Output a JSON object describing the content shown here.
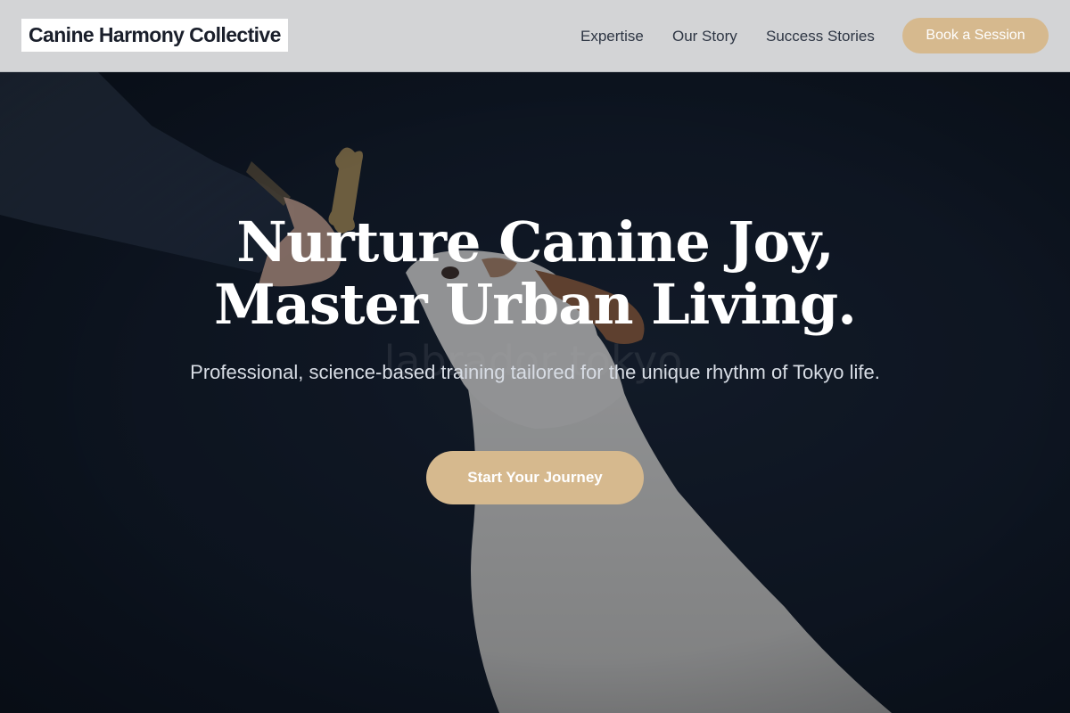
{
  "header": {
    "logo_text": "Canine Harmony Collective",
    "nav": [
      {
        "label": "Expertise"
      },
      {
        "label": "Our Story"
      },
      {
        "label": "Success Stories"
      }
    ],
    "cta_label": "Book a Session"
  },
  "hero": {
    "title_line_1": "Nurture Canine Joy,",
    "title_line_2": "Master Urban Living.",
    "subtitle": "Professional, science-based training tailored for the unique rhythm of Tokyo life.",
    "cta_label": "Start Your Journey",
    "image_caption_faint": "labrador tokyo"
  },
  "colors": {
    "header_bg": "#d3d4d6",
    "accent": "#d6b98e",
    "hero_bg": "#0e1622",
    "text_dark": "#2e3644",
    "text_light": "#ffffff"
  }
}
